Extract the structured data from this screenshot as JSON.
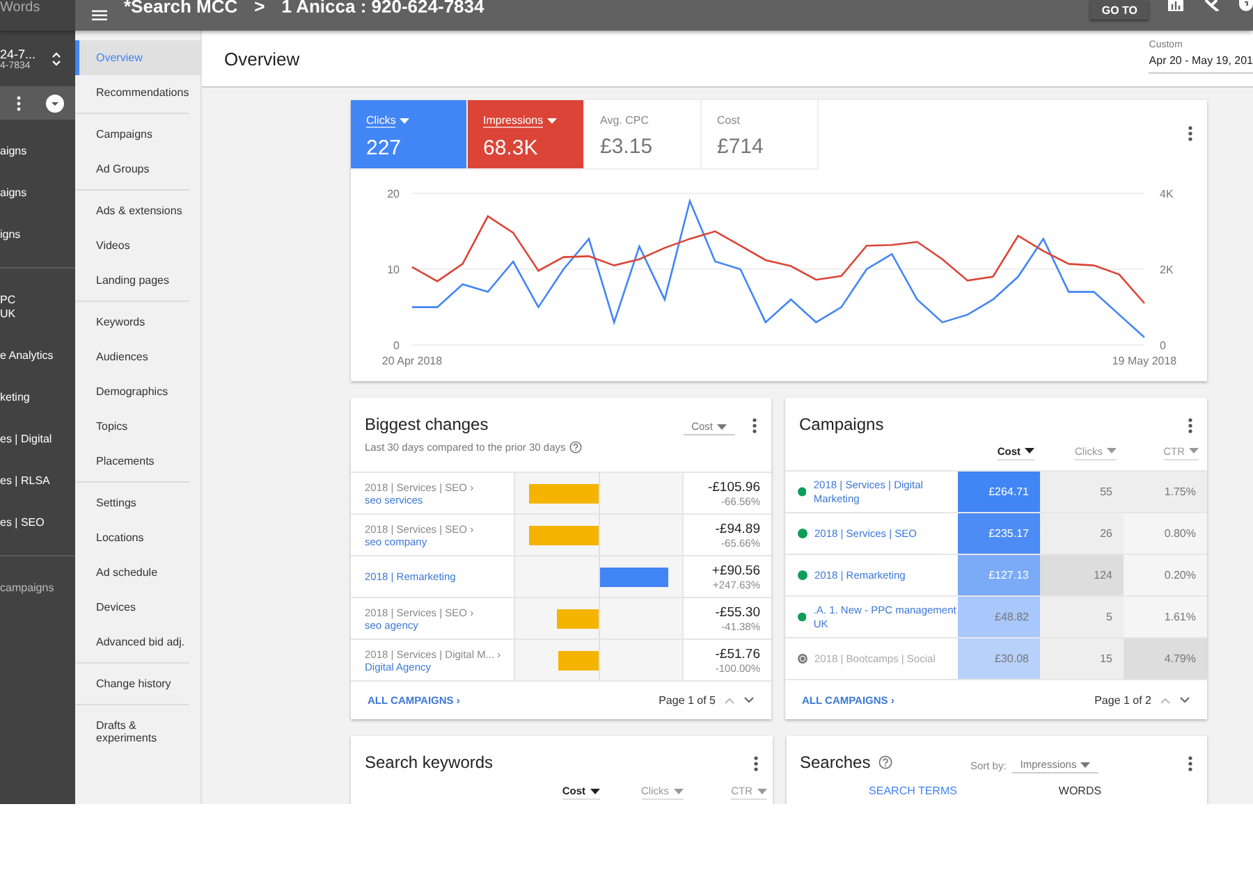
{
  "top_bar": {
    "product": "Words",
    "breadcrumb": [
      "*Search MCC",
      "1 Anicca : 920-624-7834"
    ],
    "separator": ">",
    "goto_button": "GO TO"
  },
  "account_sidebar": {
    "account_name": "24-7...",
    "account_id": "4-7834",
    "groups": [
      [
        "aigns",
        "aigns",
        "igns"
      ],
      [
        "PC\nUK",
        "e Analytics",
        "keting",
        "es | Digital",
        "es | RLSA",
        "es | SEO"
      ],
      [
        "campaigns"
      ]
    ]
  },
  "nav": {
    "groups": [
      [
        {
          "label": "Overview",
          "selected": true
        },
        {
          "label": "Recommendations",
          "selected": false
        }
      ],
      [
        {
          "label": "Campaigns",
          "selected": false
        },
        {
          "label": "Ad Groups",
          "selected": false
        }
      ],
      [
        {
          "label": "Ads & extensions",
          "selected": false
        },
        {
          "label": "Videos",
          "selected": false
        },
        {
          "label": "Landing pages",
          "selected": false
        }
      ],
      [
        {
          "label": "Keywords",
          "selected": false
        },
        {
          "label": "Audiences",
          "selected": false
        },
        {
          "label": "Demographics",
          "selected": false
        },
        {
          "label": "Topics",
          "selected": false
        },
        {
          "label": "Placements",
          "selected": false
        }
      ],
      [
        {
          "label": "Settings",
          "selected": false
        },
        {
          "label": "Locations",
          "selected": false
        },
        {
          "label": "Ad schedule",
          "selected": false
        },
        {
          "label": "Devices",
          "selected": false
        },
        {
          "label": "Advanced bid adj.",
          "selected": false
        }
      ],
      [
        {
          "label": "Change history",
          "selected": false
        }
      ],
      [
        {
          "label": "Drafts & experiments",
          "selected": false
        }
      ]
    ]
  },
  "header": {
    "title": "Overview",
    "date_label": "Custom",
    "date_range": "Apr 20 - May 19, 201"
  },
  "performance_card": {
    "tiles": [
      {
        "label": "Clicks",
        "value": "227",
        "selected": true,
        "color": "#4285f4"
      },
      {
        "label": "Impressions",
        "value": "68.3K",
        "selected": true,
        "color": "#db4437"
      },
      {
        "label": "Avg. CPC",
        "value": "£3.15",
        "selected": false
      },
      {
        "label": "Cost",
        "value": "£714",
        "selected": false
      }
    ],
    "chart_data": {
      "type": "line",
      "categories": [
        "20 Apr 2018",
        null,
        null,
        null,
        null,
        null,
        null,
        null,
        null,
        null,
        null,
        null,
        null,
        null,
        null,
        null,
        null,
        null,
        null,
        null,
        null,
        null,
        null,
        null,
        null,
        null,
        null,
        null,
        null,
        "19 May 2018"
      ],
      "ylim": [
        0,
        20
      ],
      "yticks": [
        0,
        10,
        20
      ],
      "y2lim": [
        0,
        4000
      ],
      "y2ticks": [
        {
          "value": 0,
          "label": "0"
        },
        {
          "value": 2000,
          "label": "2K"
        },
        {
          "value": 4000,
          "label": "4K"
        }
      ],
      "series": [
        {
          "color": "#4285f4",
          "values": [
            5,
            5,
            8,
            7,
            11,
            5,
            10,
            14,
            3,
            13,
            6,
            19,
            11,
            10,
            3,
            6,
            3,
            5,
            10,
            12,
            6,
            3,
            4,
            6,
            9,
            14,
            7,
            7,
            4,
            1
          ]
        },
        {
          "color": "#db4437",
          "axis": "y2",
          "values": [
            2060,
            1680,
            2140,
            3400,
            2960,
            1960,
            2320,
            2340,
            2100,
            2260,
            2560,
            2800,
            3000,
            2620,
            2240,
            2080,
            1720,
            1820,
            2620,
            2640,
            2720,
            2260,
            1700,
            1800,
            2880,
            2480,
            2140,
            2100,
            1860,
            1100
          ]
        }
      ]
    }
  },
  "biggest_changes": {
    "title": "Biggest changes",
    "subtitle": "Last 30 days compared to the prior 30 days",
    "metric_dropdown": "Cost",
    "rows": [
      {
        "path": "2018 | Services | SEO ›",
        "name": "seo services",
        "kind": "decrease",
        "level": 0.82,
        "change": "-£105.96",
        "percent": "-66.56%"
      },
      {
        "path": "2018 | Services | SEO ›",
        "name": "seo company",
        "kind": "decrease",
        "level": 0.82,
        "change": "-£94.89",
        "percent": "-65.66%"
      },
      {
        "name": "2018 | Remarketing",
        "kind": "increase",
        "level": 0.82,
        "change": "+£90.56",
        "percent": "+247.63%"
      },
      {
        "path": "2018 | Services | SEO ›",
        "name": "seo agency",
        "kind": "decrease",
        "level": 0.5,
        "change": "-£55.30",
        "percent": "-41.38%"
      },
      {
        "path": "2018 | Services | Digital M... ›",
        "name": "Digital Agency",
        "kind": "decrease",
        "level": 0.47,
        "change": "-£51.76",
        "percent": "-100.00%"
      }
    ],
    "footer_link": "ALL CAMPAIGNS ›",
    "pagination": "Page 1 of 5"
  },
  "campaigns": {
    "title": "Campaigns",
    "columns": [
      {
        "label": "Cost",
        "selected": true
      },
      {
        "label": "Clicks",
        "selected": false
      },
      {
        "label": "CTR",
        "selected": false
      }
    ],
    "rows": [
      {
        "name": "2018 | Services | Digital Marketing",
        "kind": "enabled",
        "cost": {
          "text": "£264.71",
          "color": "#4285f4"
        },
        "clicks": {
          "text": "55",
          "color": "#eeeeee"
        },
        "ctr": {
          "text": "1.75%",
          "color": "#eeeeee"
        }
      },
      {
        "name": "2018 | Services | SEO",
        "kind": "enabled",
        "cost": {
          "text": "£235.17",
          "color": "#4d8cf5"
        },
        "clicks": {
          "text": "26",
          "color": "#eeeeee"
        },
        "ctr": {
          "text": "0.80%",
          "color": "#f5f5f5"
        }
      },
      {
        "name": "2018 | Remarketing",
        "kind": "enabled",
        "cost": {
          "text": "£127.13",
          "color": "#7baaf7"
        },
        "clicks": {
          "text": "124",
          "color": "#dddddd"
        },
        "ctr": {
          "text": "0.20%",
          "color": "#f5f5f5"
        }
      },
      {
        "name": ".A. 1. New - PPC management UK",
        "kind": "enabled",
        "cost": {
          "text": "£48.82",
          "color": "#a8c7fa"
        },
        "clicks": {
          "text": "5",
          "color": "#eeeeee"
        },
        "ctr": {
          "text": "1.61%",
          "color": "#f5f5f5"
        }
      },
      {
        "name": "2018 | Bootcamps | Social",
        "kind": "paused",
        "cost": {
          "text": "£30.08",
          "color": "#b7d1fb"
        },
        "clicks": {
          "text": "15",
          "color": "#eeeeee"
        },
        "ctr": {
          "text": "4.79%",
          "color": "#dddddd"
        }
      }
    ],
    "footer_link": "ALL CAMPAIGNS ›",
    "pagination": "Page 1 of 2"
  },
  "search_keywords": {
    "title": "Search keywords",
    "columns": [
      {
        "label": "Cost",
        "selected": true
      },
      {
        "label": "Clicks",
        "selected": false
      },
      {
        "label": "CTR",
        "selected": false
      }
    ]
  },
  "searches": {
    "title": "Searches",
    "sort_label": "Sort by:",
    "sort_value": "Impressions",
    "tabs": [
      {
        "label": "SEARCH TERMS",
        "selected": true
      },
      {
        "label": "WORDS",
        "selected": false
      }
    ]
  }
}
